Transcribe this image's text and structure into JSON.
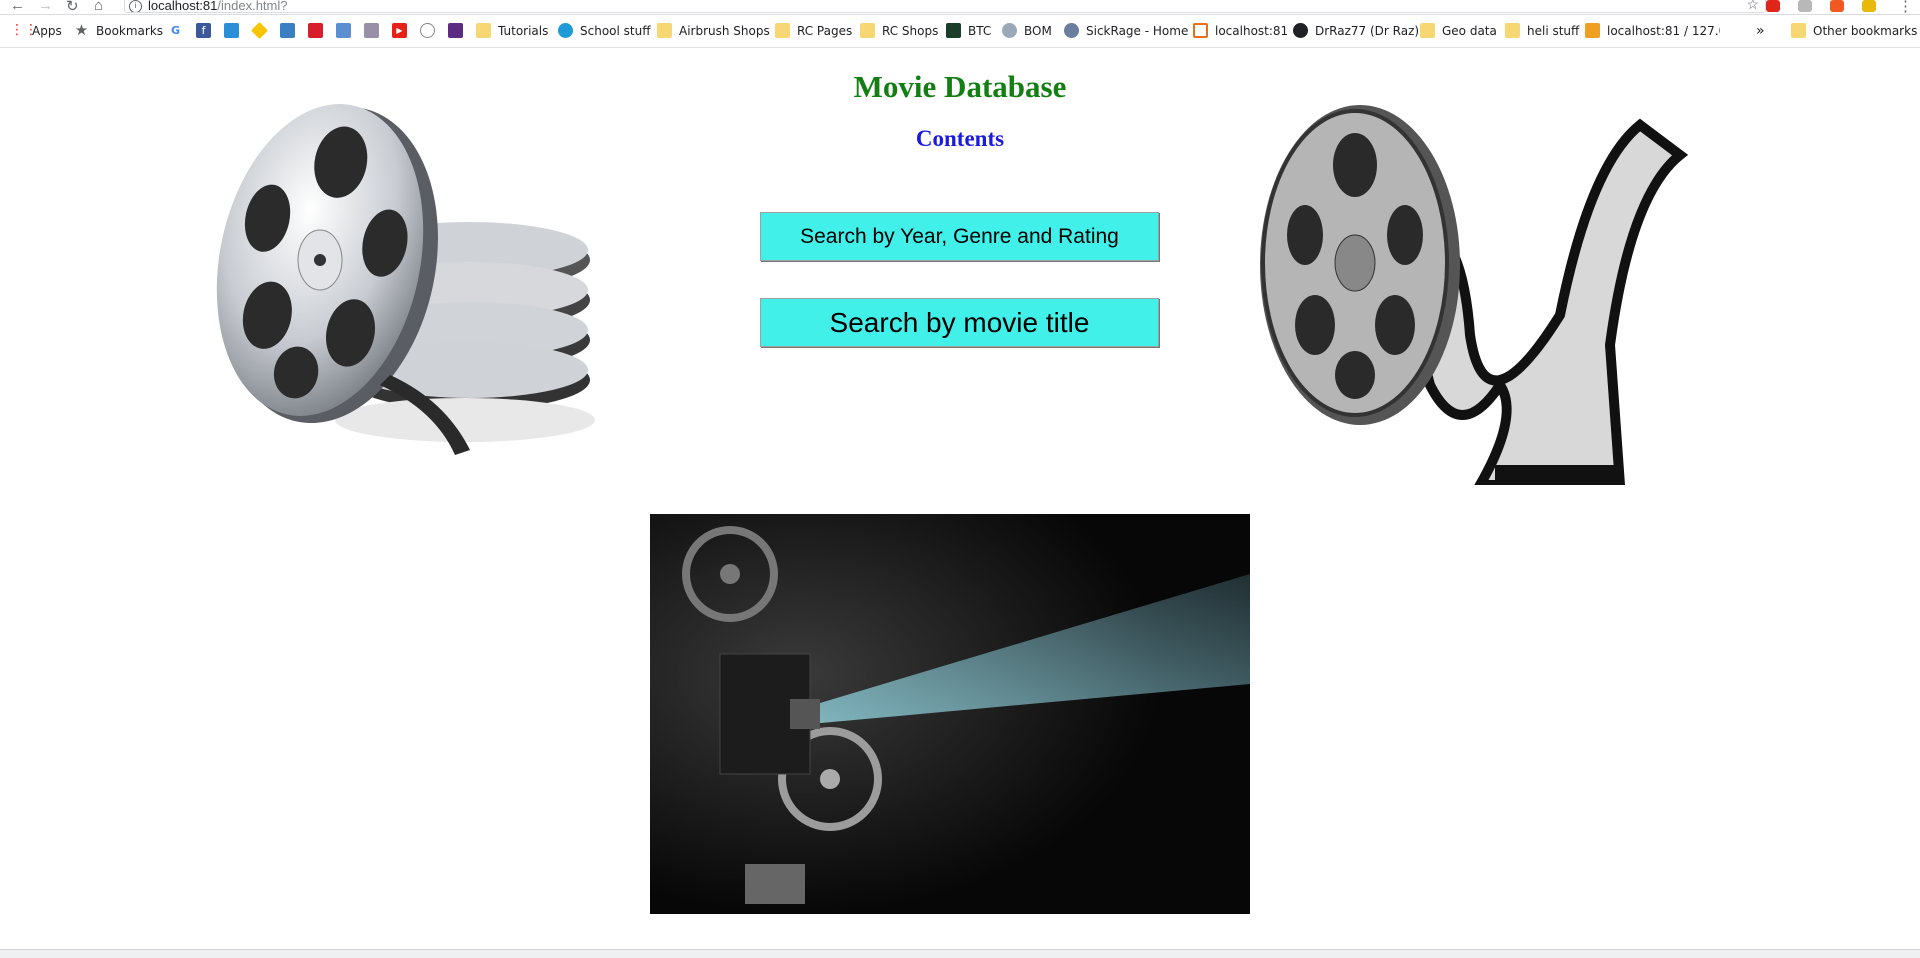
{
  "browser": {
    "url_host": "localhost:81",
    "url_path": "/index.html?",
    "bookmarks": [
      {
        "label": "Apps",
        "icon": "apps-grid-icon"
      },
      {
        "label": "Bookmarks",
        "icon": "star-icon"
      },
      {
        "label": "",
        "icon": "google-icon"
      },
      {
        "label": "",
        "icon": "facebook-icon"
      },
      {
        "label": "",
        "icon": "site-icon"
      },
      {
        "label": "",
        "icon": "site-icon"
      },
      {
        "label": "",
        "icon": "site-icon"
      },
      {
        "label": "",
        "icon": "site-icon"
      },
      {
        "label": "",
        "icon": "site-icon"
      },
      {
        "label": "",
        "icon": "site-icon"
      },
      {
        "label": "",
        "icon": "youtube-icon"
      },
      {
        "label": "",
        "icon": "reddit-icon"
      },
      {
        "label": "",
        "icon": "site-icon"
      },
      {
        "label": "Tutorials",
        "icon": "folder-icon"
      },
      {
        "label": "School stuff",
        "icon": "site-icon"
      },
      {
        "label": "Airbrush Shops",
        "icon": "folder-icon"
      },
      {
        "label": "RC Pages",
        "icon": "folder-icon"
      },
      {
        "label": "RC Shops",
        "icon": "folder-icon"
      },
      {
        "label": "BTC",
        "icon": "site-icon"
      },
      {
        "label": "BOM",
        "icon": "site-icon"
      },
      {
        "label": "SickRage - Home",
        "icon": "site-icon"
      },
      {
        "label": "localhost:81",
        "icon": "site-icon"
      },
      {
        "label": "DrRaz77 (Dr Raz)",
        "icon": "github-icon"
      },
      {
        "label": "Geo data",
        "icon": "folder-icon"
      },
      {
        "label": "heli stuff",
        "icon": "folder-icon"
      },
      {
        "label": "localhost:81 / 127.0.0",
        "icon": "site-icon"
      }
    ],
    "overflow_label": "»",
    "other_bookmarks": "Other bookmarks"
  },
  "page": {
    "title": "Movie Database",
    "subtitle": "Contents",
    "buttons": {
      "search_year_genre_rating": "Search by Year, Genre and Rating",
      "search_title": "Search by movie title"
    }
  }
}
